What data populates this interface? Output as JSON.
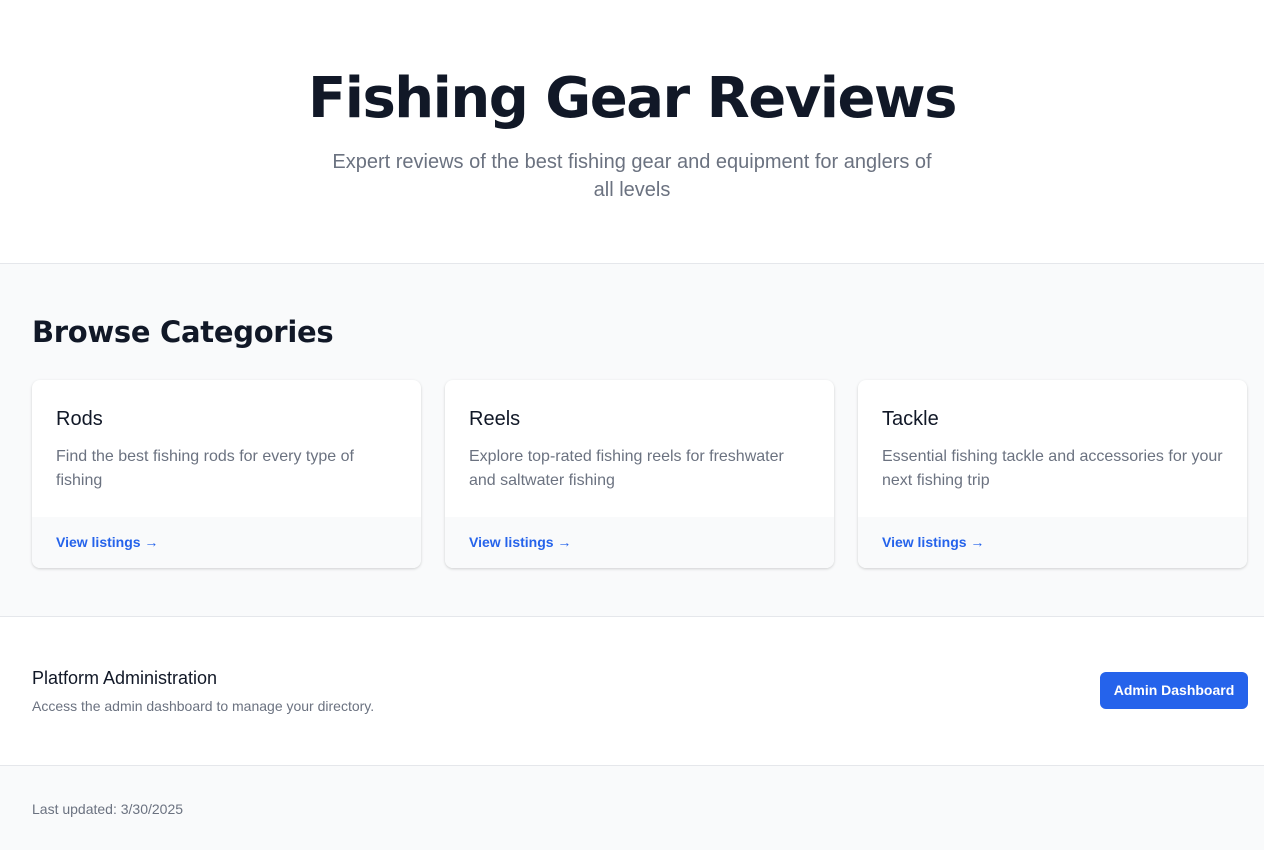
{
  "hero": {
    "title": "Fishing Gear Reviews",
    "subtitle": "Expert reviews of the best fishing gear and equipment for anglers of all levels"
  },
  "categories": {
    "heading": "Browse Categories",
    "items": [
      {
        "title": "Rods",
        "description": "Find the best fishing rods for every type of fishing",
        "link": "View listings →"
      },
      {
        "title": "Reels",
        "description": "Explore top-rated fishing reels for freshwater and saltwater fishing",
        "link": "View listings →"
      },
      {
        "title": "Tackle",
        "description": "Essential fishing tackle and accessories for your next fishing trip",
        "link": "View listings →"
      }
    ]
  },
  "admin": {
    "title": "Platform Administration",
    "description": "Access the admin dashboard to manage your directory.",
    "button_label": "Admin Dashboard"
  },
  "footer": {
    "last_updated": "Last updated: 3/30/2025"
  },
  "colors": {
    "accent": "#2563eb",
    "heading": "#111827",
    "muted": "#6b7280",
    "section_bg": "#f9fafb"
  }
}
